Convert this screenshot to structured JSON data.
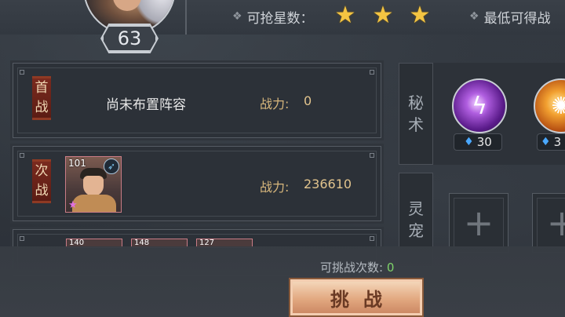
{
  "player": {
    "level": "63"
  },
  "header": {
    "stars_label": "可抢星数：",
    "stars_count": 3,
    "min_label": "最低可得战"
  },
  "lineup": {
    "rows": [
      {
        "tag": [
          "首",
          "战"
        ],
        "title": "尚未布置阵容",
        "power_label": "战力:",
        "power_value": "0"
      },
      {
        "tag": [
          "次",
          "战"
        ],
        "hero_level": "101",
        "power_label": "战力:",
        "power_value": "236610"
      },
      {
        "mini_levels": [
          "140",
          "148",
          "127"
        ]
      }
    ]
  },
  "skills": {
    "label": [
      "秘",
      "术"
    ],
    "items": [
      {
        "icon": "purple-lightning-orb",
        "cost": "30"
      },
      {
        "icon": "fire-orb",
        "cost": "3"
      }
    ]
  },
  "pets": {
    "label": [
      "灵",
      "宠"
    ]
  },
  "footer": {
    "attempts_label": "可挑战次数:",
    "attempts_value": "0",
    "challenge_label": "挑战"
  }
}
